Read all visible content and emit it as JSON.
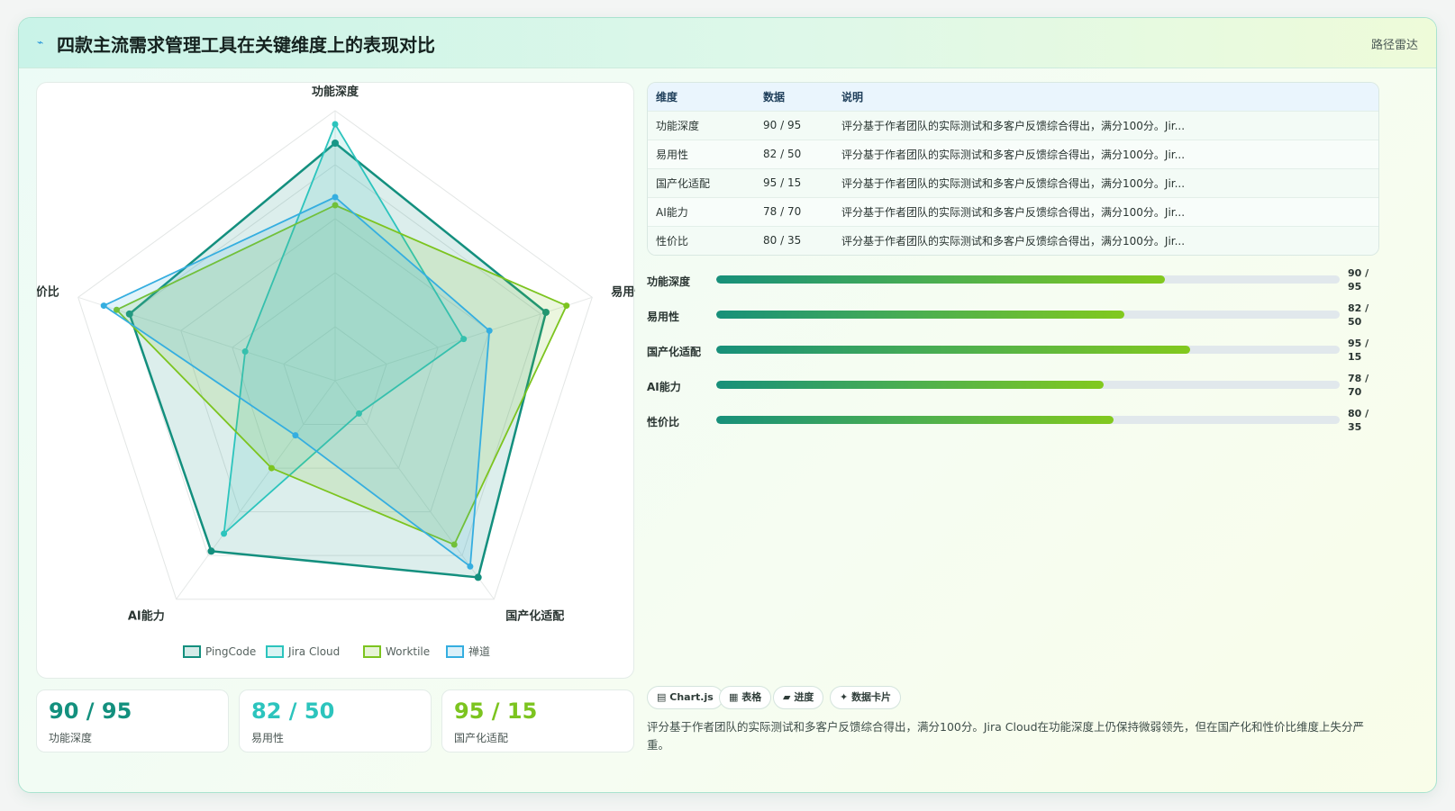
{
  "header": {
    "title_icon": "wave-icon",
    "title": "四款主流需求管理工具在关键维度上的表现对比",
    "tag": "路径雷达"
  },
  "chart_data": {
    "type": "radar",
    "categories": [
      "功能深度",
      "易用性",
      "国产化适配",
      "AI能力",
      "性价比"
    ],
    "rmax": 100,
    "grid_levels": 5,
    "series": [
      {
        "name": "PingCode",
        "color": "#138f7e",
        "values": [
          88,
          82,
          90,
          78,
          80
        ]
      },
      {
        "name": "Jira Cloud",
        "color": "#2cc4bd",
        "values": [
          95,
          50,
          15,
          70,
          35
        ]
      },
      {
        "name": "Worktile",
        "color": "#7cc41f",
        "values": [
          65,
          90,
          75,
          40,
          85
        ]
      },
      {
        "name": "禅道",
        "color": "#35aee0",
        "values": [
          68,
          60,
          85,
          25,
          90
        ]
      }
    ],
    "legend_position": "bottom"
  },
  "stats": [
    {
      "value": "90 / 95",
      "label": "功能深度",
      "color": "#13907e"
    },
    {
      "value": "82 / 50",
      "label": "易用性",
      "color": "#2cc4bd"
    },
    {
      "value": "95 / 15",
      "label": "国产化适配",
      "color": "#7cc41f"
    }
  ],
  "table": {
    "headers": [
      "维度",
      "数据",
      "说明"
    ],
    "rows": [
      [
        "功能深度",
        "90 / 95",
        "评分基于作者团队的实际测试和多客户反馈综合得出，满分100分。Jir..."
      ],
      [
        "易用性",
        "82 / 50",
        "评分基于作者团队的实际测试和多客户反馈综合得出，满分100分。Jir..."
      ],
      [
        "国产化适配",
        "95 / 15",
        "评分基于作者团队的实际测试和多客户反馈综合得出，满分100分。Jir..."
      ],
      [
        "AI能力",
        "78 / 70",
        "评分基于作者团队的实际测试和多客户反馈综合得出，满分100分。Jir..."
      ],
      [
        "性价比",
        "80 / 35",
        "评分基于作者团队的实际测试和多客户反馈综合得出，满分100分。Jir..."
      ]
    ]
  },
  "progress": [
    {
      "label": "功能深度",
      "value": "90 / 95",
      "fraction": 0.72
    },
    {
      "label": "易用性",
      "value": "82 / 50",
      "fraction": 0.655
    },
    {
      "label": "国产化适配",
      "value": "95 / 15",
      "fraction": 0.76
    },
    {
      "label": "AI能力",
      "value": "78 / 70",
      "fraction": 0.622
    },
    {
      "label": "性价比",
      "value": "80 / 35",
      "fraction": 0.637
    }
  ],
  "chips": [
    {
      "icon": "chart-icon",
      "glyph": "▤",
      "label": "Chart.js"
    },
    {
      "icon": "table-icon",
      "glyph": "▦",
      "label": "表格"
    },
    {
      "icon": "progress-icon",
      "glyph": "▰",
      "label": "进度"
    },
    {
      "icon": "sparkle-icon",
      "glyph": "✦",
      "label": "数据卡片"
    }
  ],
  "note": "评分基于作者团队的实际测试和多客户反馈综合得出，满分100分。Jira Cloud在功能深度上仍保持微弱领先，但在国产化和性价比维度上失分严重。"
}
